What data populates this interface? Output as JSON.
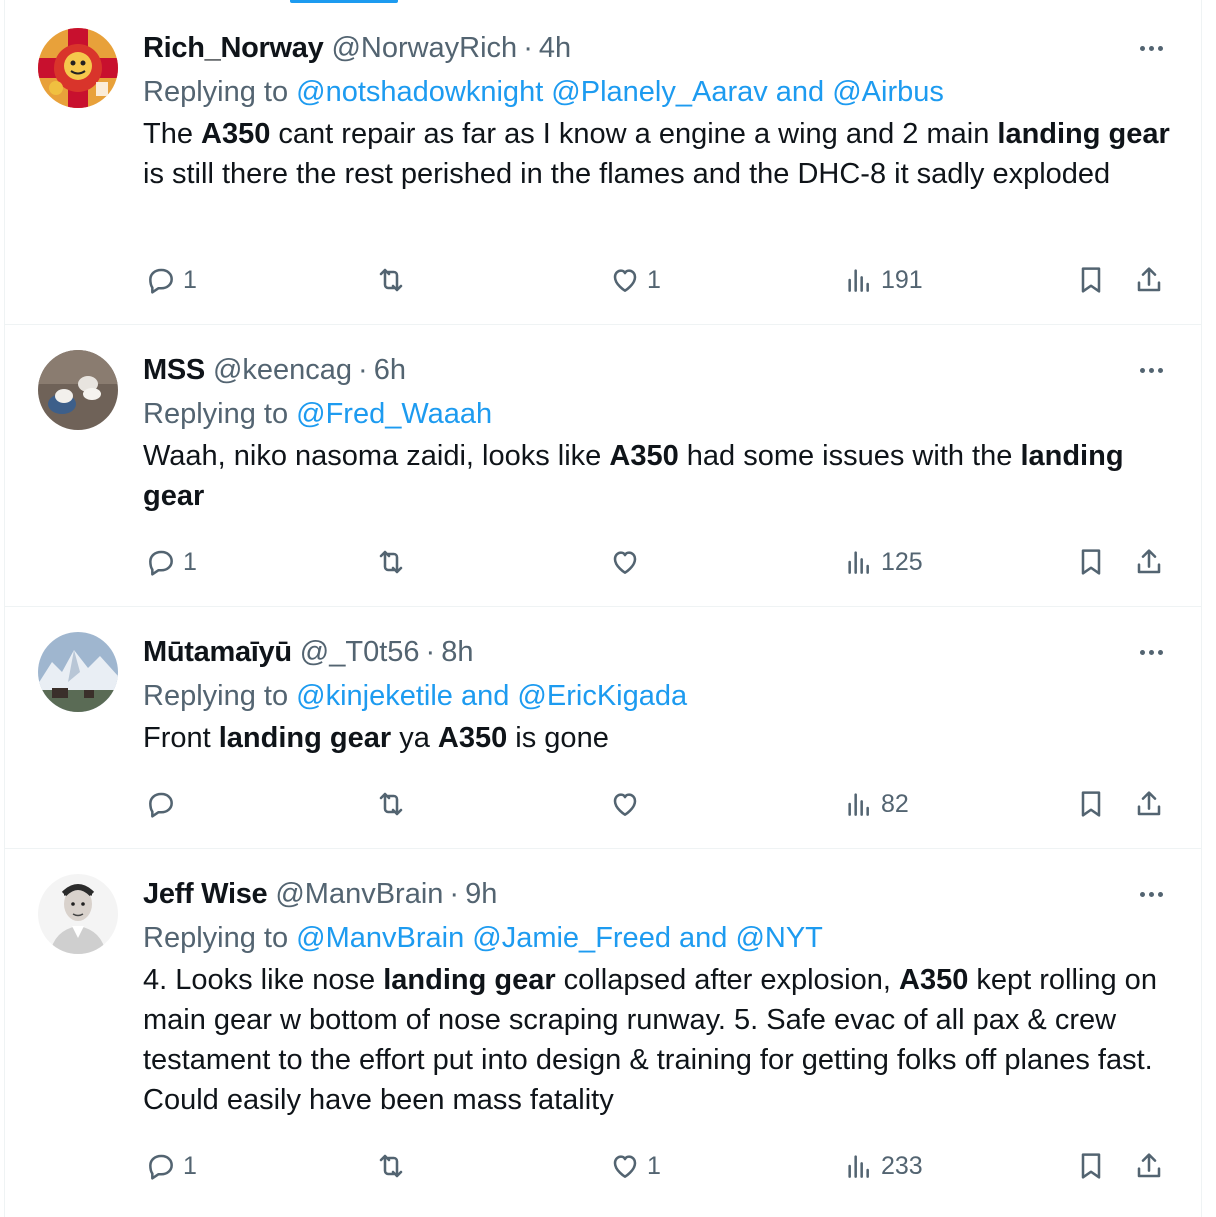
{
  "tweets": [
    {
      "name": "Rich_Norway",
      "handle": "@NorwayRich",
      "separator": "·",
      "time": "4h",
      "replying_prefix": "Replying to",
      "replying_mentions": "@notshadowknight @Planely_Aarav and @Airbus",
      "text_parts": [
        {
          "t": "The ",
          "b": false
        },
        {
          "t": "A350",
          "b": true
        },
        {
          "t": " cant repair as far as I know a engine a wing and 2 main ",
          "b": false
        },
        {
          "t": "landing gear",
          "b": true
        },
        {
          "t": " is still there the rest perished in the flames and the DHC-8 it sadly exploded",
          "b": false
        }
      ],
      "replies": "1",
      "retweets": "",
      "likes": "1",
      "views": "191"
    },
    {
      "name": "MSS",
      "handle": "@keencag",
      "separator": "·",
      "time": "6h",
      "replying_prefix": "Replying to",
      "replying_mentions": "@Fred_Waaah",
      "text_parts": [
        {
          "t": "Waah, niko nasoma zaidi, looks like ",
          "b": false
        },
        {
          "t": "A350",
          "b": true
        },
        {
          "t": " had some issues with the ",
          "b": false
        },
        {
          "t": "landing gear",
          "b": true
        }
      ],
      "replies": "1",
      "retweets": "",
      "likes": "",
      "views": "125"
    },
    {
      "name": "Mūtamaīyū",
      "handle": "@_T0t56",
      "separator": "·",
      "time": "8h",
      "replying_prefix": "Replying to",
      "replying_mentions": "@kinjeketile and @EricKigada",
      "text_parts": [
        {
          "t": "Front ",
          "b": false
        },
        {
          "t": "landing gear",
          "b": true
        },
        {
          "t": " ya ",
          "b": false
        },
        {
          "t": "A350",
          "b": true
        },
        {
          "t": " is gone",
          "b": false
        }
      ],
      "replies": "",
      "retweets": "",
      "likes": "",
      "views": "82"
    },
    {
      "name": "Jeff Wise",
      "handle": "@ManvBrain",
      "separator": "·",
      "time": "9h",
      "replying_prefix": "Replying to",
      "replying_mentions": "@ManvBrain @Jamie_Freed and @NYT",
      "text_parts": [
        {
          "t": "4. Looks like nose ",
          "b": false
        },
        {
          "t": "landing gear",
          "b": true
        },
        {
          "t": " collapsed after explosion, ",
          "b": false
        },
        {
          "t": "A350",
          "b": true
        },
        {
          "t": " kept rolling on main gear w bottom of nose scraping runway. 5. Safe evac of all pax & crew testament to the effort put into design & training for getting folks off planes fast. Could easily have been mass fatality",
          "b": false
        }
      ],
      "replies": "1",
      "retweets": "",
      "likes": "1",
      "views": "233"
    }
  ],
  "icons": {
    "reply": "reply-icon",
    "retweet": "retweet-icon",
    "like": "heart-icon",
    "views": "views-icon",
    "bookmark": "bookmark-icon",
    "share": "share-icon",
    "more": "more-icon"
  },
  "colors": {
    "accent": "#1d9bf0",
    "text": "#0f1419",
    "secondary": "#536471",
    "border": "#eff3f4"
  }
}
